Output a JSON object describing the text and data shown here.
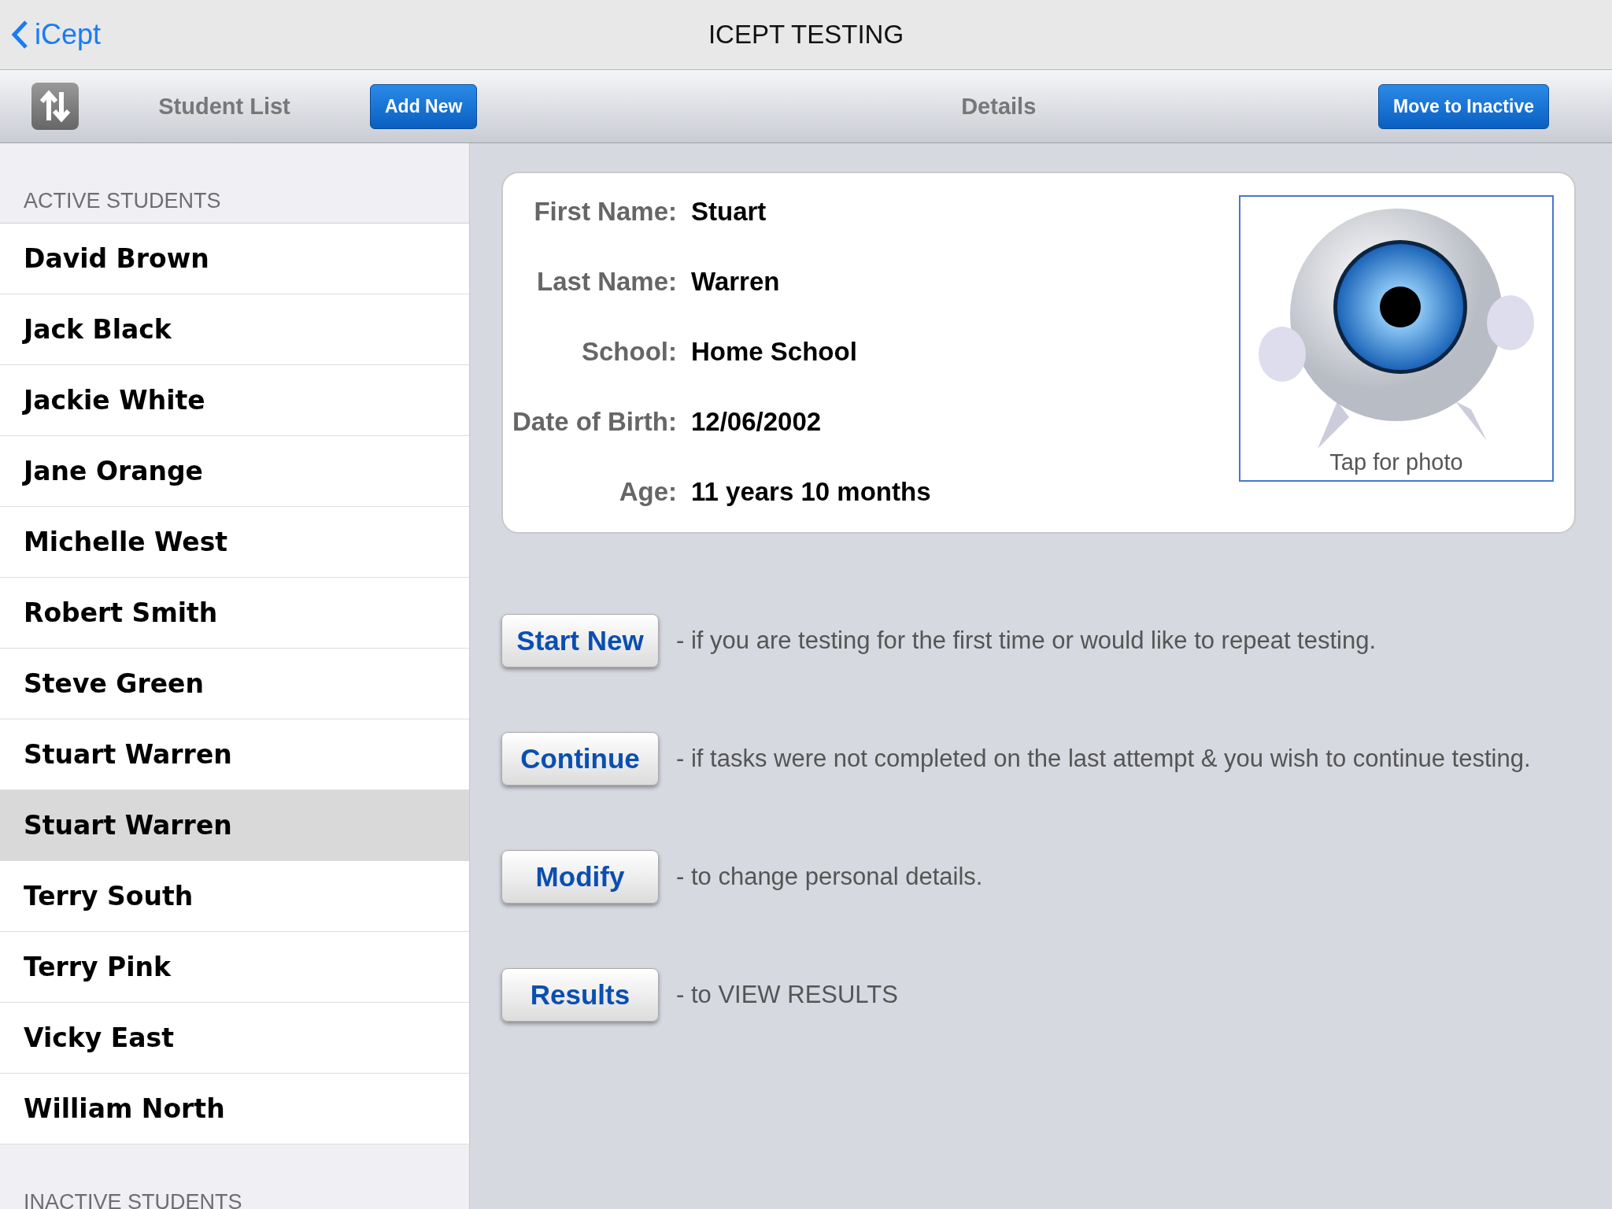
{
  "nav": {
    "back": "iCept",
    "title": "ICEPT TESTING"
  },
  "toolbar": {
    "list_title": "Student List",
    "add_button": "Add New",
    "details_title": "Details",
    "inactive_button": "Move to Inactive"
  },
  "sidebar": {
    "sections": [
      {
        "header": "ACTIVE STUDENTS",
        "items": [
          {
            "name": "David Brown",
            "selected": false
          },
          {
            "name": "Jack Black",
            "selected": false
          },
          {
            "name": "Jackie White",
            "selected": false
          },
          {
            "name": "Jane Orange",
            "selected": false
          },
          {
            "name": "Michelle West",
            "selected": false
          },
          {
            "name": "Robert Smith",
            "selected": false
          },
          {
            "name": "Steve Green",
            "selected": false
          },
          {
            "name": "Stuart Warren",
            "selected": false
          },
          {
            "name": "Stuart Warren",
            "selected": true
          },
          {
            "name": "Terry South",
            "selected": false
          },
          {
            "name": "Terry Pink",
            "selected": false
          },
          {
            "name": "Vicky East",
            "selected": false
          },
          {
            "name": "William North",
            "selected": false
          }
        ]
      },
      {
        "header": "INACTIVE STUDENTS"
      }
    ]
  },
  "details": {
    "fields": [
      {
        "label": "First Name:",
        "value": "Stuart"
      },
      {
        "label": "Last Name:",
        "value": "Warren"
      },
      {
        "label": "School:",
        "value": "Home School"
      },
      {
        "label": "Date of Birth:",
        "value": "12/06/2002"
      },
      {
        "label": "Age:",
        "value": "11 years 10 months"
      }
    ],
    "photo_caption": "Tap for photo"
  },
  "actions": [
    {
      "button": "Start New",
      "description": "- if you are testing for the first time or would like to repeat testing."
    },
    {
      "button": "Continue",
      "description": "- if tasks were not completed on the last attempt & you wish to continue testing."
    },
    {
      "button": "Modify",
      "description": "- to change personal details."
    },
    {
      "button": "Results",
      "description": "- to VIEW RESULTS"
    }
  ]
}
